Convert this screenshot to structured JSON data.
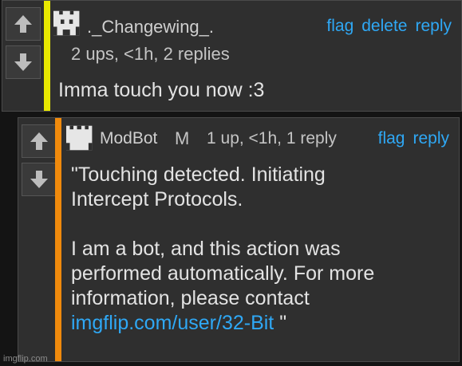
{
  "comments": [
    {
      "username": "._Changewing_.",
      "meta": "2 ups, <1h, 2 replies",
      "body": "Imma touch you now :3",
      "actions": [
        "flag",
        "delete",
        "reply"
      ],
      "accent_color": "#e8e800"
    },
    {
      "username": "ModBot",
      "mod_badge": "M",
      "meta": "1 up, <1h, 1 reply",
      "body_lines": [
        "\"Touching detected. Initiating",
        "Intercept Protocols.",
        "I am a bot, and this action was",
        "performed automatically. For more",
        "information, please contact"
      ],
      "link": "imgflip.com/user/32-Bit",
      "link_suffix": " \"",
      "actions": [
        "flag",
        "reply"
      ],
      "accent_color": "#f08a0c"
    }
  ],
  "watermark": "imgflip.com",
  "icons": {
    "up": "arrow-up-icon",
    "down": "arrow-down-icon",
    "avatar": "pixel-avatar-icon"
  }
}
